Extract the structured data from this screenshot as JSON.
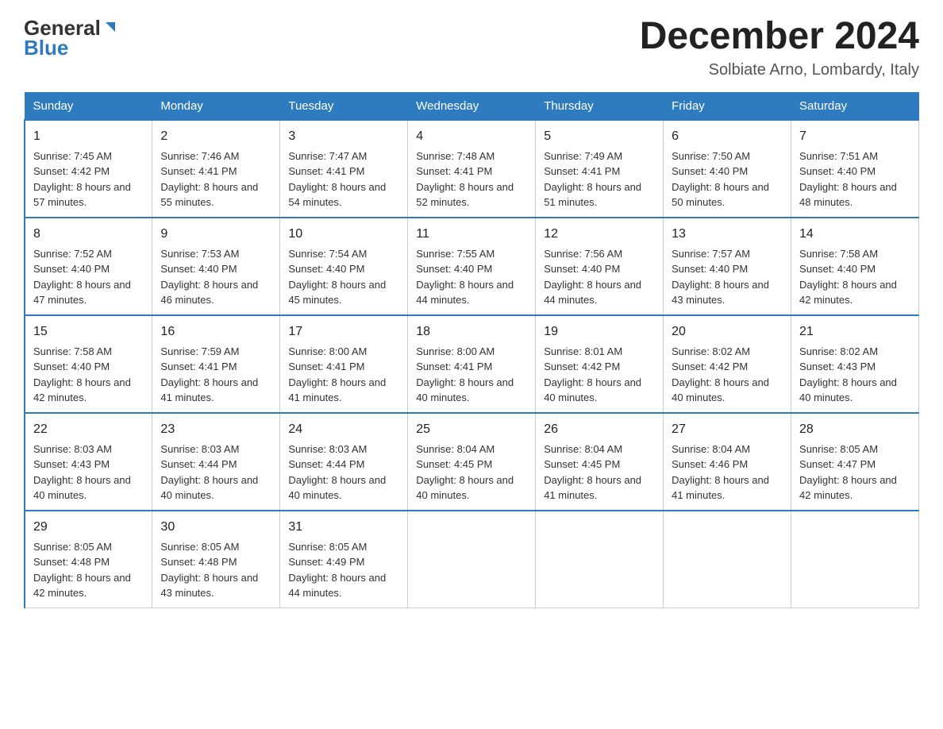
{
  "logo": {
    "text_general": "General",
    "triangle": "▶",
    "text_blue": "Blue"
  },
  "title": "December 2024",
  "subtitle": "Solbiate Arno, Lombardy, Italy",
  "days_of_week": [
    "Sunday",
    "Monday",
    "Tuesday",
    "Wednesday",
    "Thursday",
    "Friday",
    "Saturday"
  ],
  "weeks": [
    [
      {
        "day": "1",
        "sunrise": "7:45 AM",
        "sunset": "4:42 PM",
        "daylight": "8 hours and 57 minutes."
      },
      {
        "day": "2",
        "sunrise": "7:46 AM",
        "sunset": "4:41 PM",
        "daylight": "8 hours and 55 minutes."
      },
      {
        "day": "3",
        "sunrise": "7:47 AM",
        "sunset": "4:41 PM",
        "daylight": "8 hours and 54 minutes."
      },
      {
        "day": "4",
        "sunrise": "7:48 AM",
        "sunset": "4:41 PM",
        "daylight": "8 hours and 52 minutes."
      },
      {
        "day": "5",
        "sunrise": "7:49 AM",
        "sunset": "4:41 PM",
        "daylight": "8 hours and 51 minutes."
      },
      {
        "day": "6",
        "sunrise": "7:50 AM",
        "sunset": "4:40 PM",
        "daylight": "8 hours and 50 minutes."
      },
      {
        "day": "7",
        "sunrise": "7:51 AM",
        "sunset": "4:40 PM",
        "daylight": "8 hours and 48 minutes."
      }
    ],
    [
      {
        "day": "8",
        "sunrise": "7:52 AM",
        "sunset": "4:40 PM",
        "daylight": "8 hours and 47 minutes."
      },
      {
        "day": "9",
        "sunrise": "7:53 AM",
        "sunset": "4:40 PM",
        "daylight": "8 hours and 46 minutes."
      },
      {
        "day": "10",
        "sunrise": "7:54 AM",
        "sunset": "4:40 PM",
        "daylight": "8 hours and 45 minutes."
      },
      {
        "day": "11",
        "sunrise": "7:55 AM",
        "sunset": "4:40 PM",
        "daylight": "8 hours and 44 minutes."
      },
      {
        "day": "12",
        "sunrise": "7:56 AM",
        "sunset": "4:40 PM",
        "daylight": "8 hours and 44 minutes."
      },
      {
        "day": "13",
        "sunrise": "7:57 AM",
        "sunset": "4:40 PM",
        "daylight": "8 hours and 43 minutes."
      },
      {
        "day": "14",
        "sunrise": "7:58 AM",
        "sunset": "4:40 PM",
        "daylight": "8 hours and 42 minutes."
      }
    ],
    [
      {
        "day": "15",
        "sunrise": "7:58 AM",
        "sunset": "4:40 PM",
        "daylight": "8 hours and 42 minutes."
      },
      {
        "day": "16",
        "sunrise": "7:59 AM",
        "sunset": "4:41 PM",
        "daylight": "8 hours and 41 minutes."
      },
      {
        "day": "17",
        "sunrise": "8:00 AM",
        "sunset": "4:41 PM",
        "daylight": "8 hours and 41 minutes."
      },
      {
        "day": "18",
        "sunrise": "8:00 AM",
        "sunset": "4:41 PM",
        "daylight": "8 hours and 40 minutes."
      },
      {
        "day": "19",
        "sunrise": "8:01 AM",
        "sunset": "4:42 PM",
        "daylight": "8 hours and 40 minutes."
      },
      {
        "day": "20",
        "sunrise": "8:02 AM",
        "sunset": "4:42 PM",
        "daylight": "8 hours and 40 minutes."
      },
      {
        "day": "21",
        "sunrise": "8:02 AM",
        "sunset": "4:43 PM",
        "daylight": "8 hours and 40 minutes."
      }
    ],
    [
      {
        "day": "22",
        "sunrise": "8:03 AM",
        "sunset": "4:43 PM",
        "daylight": "8 hours and 40 minutes."
      },
      {
        "day": "23",
        "sunrise": "8:03 AM",
        "sunset": "4:44 PM",
        "daylight": "8 hours and 40 minutes."
      },
      {
        "day": "24",
        "sunrise": "8:03 AM",
        "sunset": "4:44 PM",
        "daylight": "8 hours and 40 minutes."
      },
      {
        "day": "25",
        "sunrise": "8:04 AM",
        "sunset": "4:45 PM",
        "daylight": "8 hours and 40 minutes."
      },
      {
        "day": "26",
        "sunrise": "8:04 AM",
        "sunset": "4:45 PM",
        "daylight": "8 hours and 41 minutes."
      },
      {
        "day": "27",
        "sunrise": "8:04 AM",
        "sunset": "4:46 PM",
        "daylight": "8 hours and 41 minutes."
      },
      {
        "day": "28",
        "sunrise": "8:05 AM",
        "sunset": "4:47 PM",
        "daylight": "8 hours and 42 minutes."
      }
    ],
    [
      {
        "day": "29",
        "sunrise": "8:05 AM",
        "sunset": "4:48 PM",
        "daylight": "8 hours and 42 minutes."
      },
      {
        "day": "30",
        "sunrise": "8:05 AM",
        "sunset": "4:48 PM",
        "daylight": "8 hours and 43 minutes."
      },
      {
        "day": "31",
        "sunrise": "8:05 AM",
        "sunset": "4:49 PM",
        "daylight": "8 hours and 44 minutes."
      },
      null,
      null,
      null,
      null
    ]
  ],
  "labels": {
    "sunrise": "Sunrise:",
    "sunset": "Sunset:",
    "daylight": "Daylight:"
  }
}
